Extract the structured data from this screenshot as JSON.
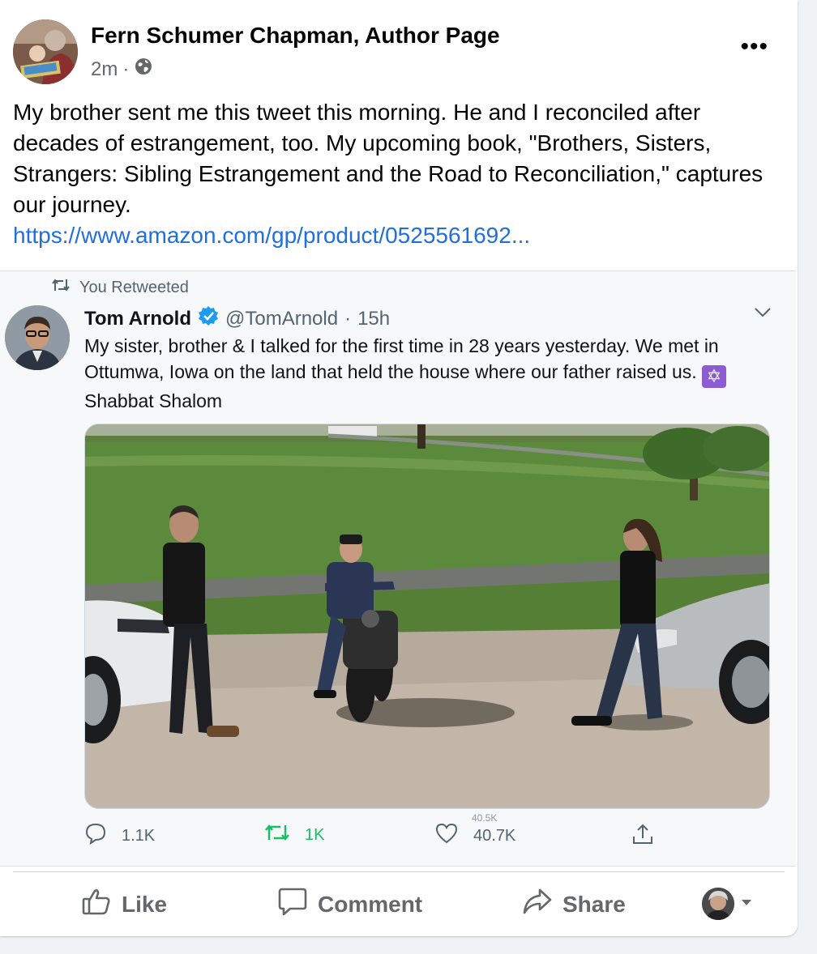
{
  "post": {
    "page_name": "Fern Schumer Chapman, Author Page",
    "time": "2m",
    "separator": "·",
    "audience_icon": "globe-icon",
    "more_label": "•••",
    "text": "My brother sent me this tweet this morning. He and I reconciled after decades of estrangement, too. My upcoming book, \"Brothers, Sisters, Strangers: Sibling Estrangement and the Road to Reconciliation,\" captures our journey.",
    "link": "https://www.amazon.com/gp/product/0525561692..."
  },
  "tweet": {
    "retweet_label": "You Retweeted",
    "author_name": "Tom Arnold",
    "handle": "@TomArnold",
    "separator": "·",
    "age": "15h",
    "text_main": "My sister, brother & I talked for the first time in 28 years yesterday. We met in Ottumwa, Iowa on the land that held the house where our father raised us.",
    "text_tail": "Shabbat Shalom",
    "emoji_glyph": "✡",
    "actions": {
      "replies": "1.1K",
      "retweets": "1K",
      "likes": "40.7K",
      "likes_ghost": "40.5K"
    }
  },
  "actions": {
    "like": "Like",
    "comment": "Comment",
    "share": "Share"
  },
  "colors": {
    "link": "#216fdb",
    "retweet_green": "#17bf63",
    "verified_blue": "#1d9bf0",
    "muted": "#65676b"
  }
}
